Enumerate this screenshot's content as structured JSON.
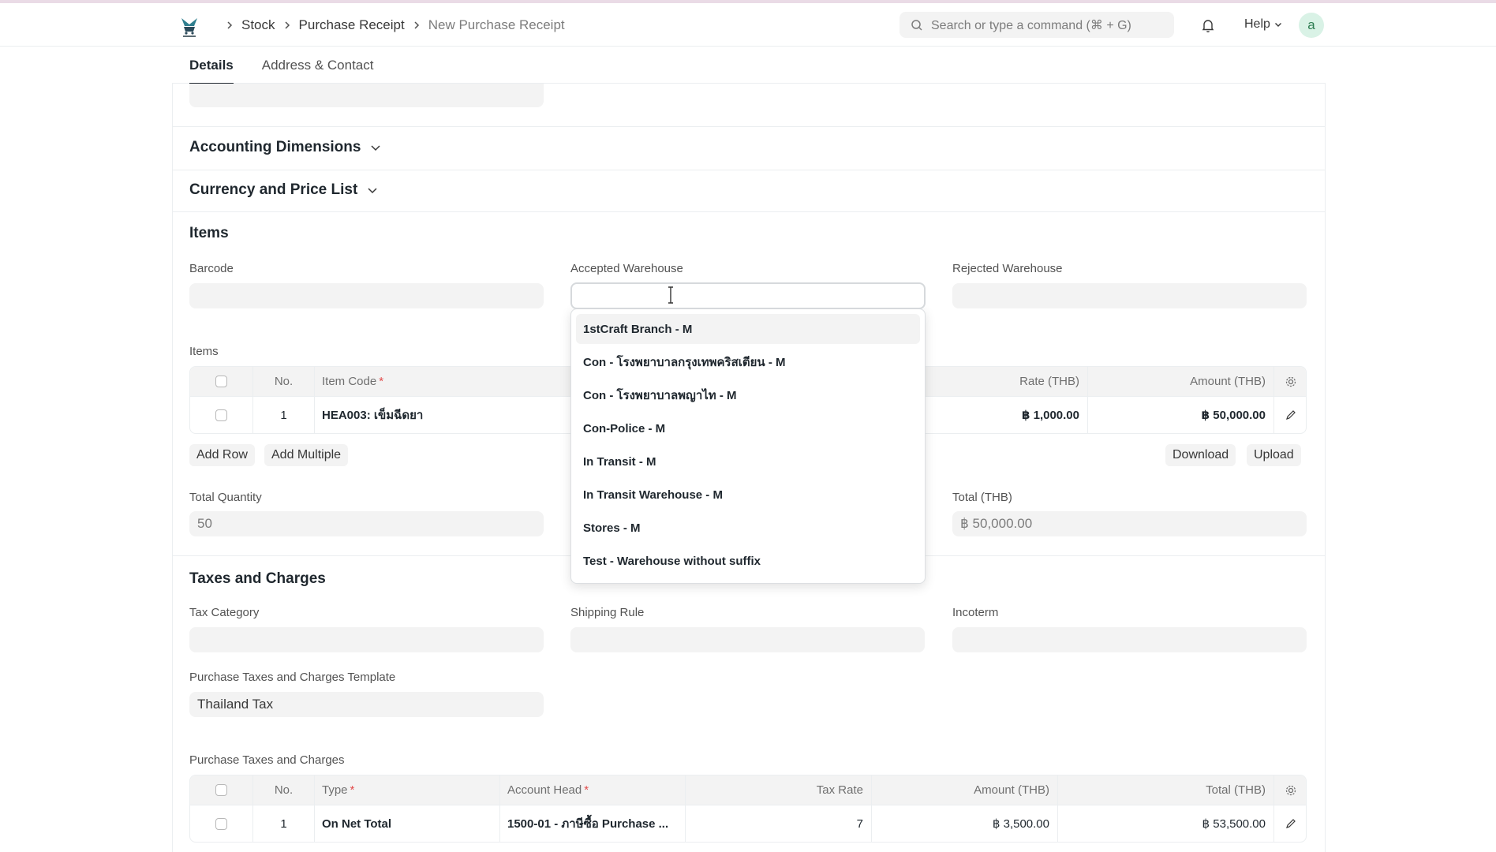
{
  "navbar": {
    "breadcrumbs": [
      "Stock",
      "Purchase Receipt",
      "New Purchase Receipt"
    ],
    "search_placeholder": "Search or type a command (⌘ + G)",
    "help_label": "Help",
    "avatar_initial": "a"
  },
  "tabs": [
    {
      "label": "Details",
      "active": true
    },
    {
      "label": "Address & Contact",
      "active": false
    }
  ],
  "sections": {
    "accounting_dimensions": "Accounting Dimensions",
    "currency_price_list": "Currency and Price List",
    "items": "Items",
    "taxes_charges": "Taxes and Charges"
  },
  "items_section": {
    "barcode_label": "Barcode",
    "accepted_warehouse_label": "Accepted Warehouse",
    "rejected_warehouse_label": "Rejected Warehouse",
    "items_table_label": "Items",
    "table_headers": {
      "no": "No.",
      "item_code": "Item Code",
      "rate": "Rate (THB)",
      "amount": "Amount (THB)"
    },
    "rows": [
      {
        "no": "1",
        "item_code": "HEA003: เข็มฉีดยา",
        "rate": "฿ 1,000.00",
        "amount": "฿ 50,000.00"
      }
    ],
    "buttons": {
      "add_row": "Add Row",
      "add_multiple": "Add Multiple",
      "download": "Download",
      "upload": "Upload"
    },
    "total_quantity_label": "Total Quantity",
    "total_quantity_value": "50",
    "total_label": "Total (THB)",
    "total_value": "฿ 50,000.00"
  },
  "warehouse_dropdown": {
    "options": [
      "1stCraft Branch - M",
      "Con - โรงพยาบาลกรุงเทพคริสเตียน - M",
      "Con - โรงพยาบาลพญาไท - M",
      "Con-Police - M",
      "In Transit - M",
      "In Transit Warehouse - M",
      "Stores - M",
      "Test - Warehouse without suffix"
    ],
    "highlighted_index": 0
  },
  "taxes_section": {
    "tax_category_label": "Tax Category",
    "shipping_rule_label": "Shipping Rule",
    "incoterm_label": "Incoterm",
    "template_label": "Purchase Taxes and Charges Template",
    "template_value": "Thailand Tax",
    "table_label": "Purchase Taxes and Charges",
    "table_headers": {
      "no": "No.",
      "type": "Type",
      "account_head": "Account Head",
      "tax_rate": "Tax Rate",
      "amount": "Amount (THB)",
      "total": "Total (THB)"
    },
    "rows": [
      {
        "no": "1",
        "type": "On Net Total",
        "account_head": "1500-01 - ภาษีซื้อ Purchase ...",
        "tax_rate": "7",
        "amount": "฿ 3,500.00",
        "total": "฿ 53,500.00"
      }
    ]
  },
  "colors": {
    "accent_line": "#eadbe6",
    "avatar_bg": "#d9f2e6",
    "required": "#e24c4c"
  }
}
